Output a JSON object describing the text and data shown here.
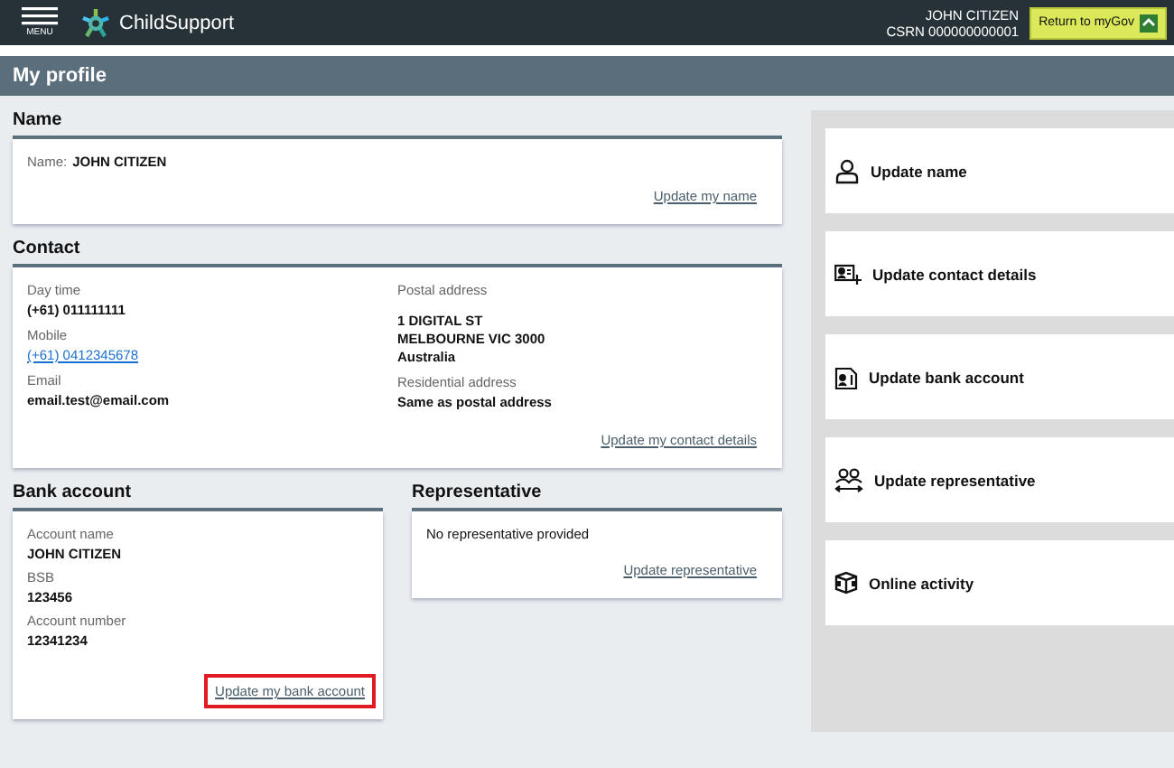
{
  "header": {
    "menu_label": "MENU",
    "brand": "ChildSupport",
    "user_name": "JOHN CITIZEN",
    "csrn": "CSRN 000000000001",
    "return_button": "Return to myGov"
  },
  "page_title": "My profile",
  "name_section": {
    "title": "Name",
    "label": "Name:",
    "value": "JOHN CITIZEN",
    "link": "Update my name"
  },
  "contact_section": {
    "title": "Contact",
    "left": [
      {
        "label": "Day time",
        "lines": [
          "(+61) 011111111"
        ],
        "kind": "text"
      },
      {
        "label": "Mobile",
        "lines": [
          "(+61) 0412345678"
        ],
        "kind": "link"
      },
      {
        "label": "Email",
        "lines": [
          "email.test@email.com"
        ],
        "kind": "text"
      }
    ],
    "right": [
      {
        "label": "Postal address",
        "lines": [
          "1 DIGITAL ST",
          "MELBOURNE VIC 3000",
          "Australia"
        ],
        "kind": "text"
      },
      {
        "label": "Residential address",
        "lines": [
          "Same as postal address"
        ],
        "kind": "text"
      }
    ],
    "link": "Update my contact details"
  },
  "bank_section": {
    "title": "Bank account",
    "fields": [
      {
        "label": "Account name",
        "value": "JOHN CITIZEN"
      },
      {
        "label": "BSB",
        "value": "123456"
      },
      {
        "label": "Account number",
        "value": "12341234"
      }
    ],
    "link": "Update my bank account",
    "highlighted": true
  },
  "representative_section": {
    "title": "Representative",
    "text": "No representative provided",
    "link": "Update representative"
  },
  "actions": [
    {
      "label": "Update name",
      "kind": "person"
    },
    {
      "label": "Update contact details",
      "kind": "contact"
    },
    {
      "label": "Update bank account",
      "kind": "bank"
    },
    {
      "label": "Update representative",
      "kind": "people"
    },
    {
      "label": "Online activity",
      "kind": "activity"
    }
  ]
}
